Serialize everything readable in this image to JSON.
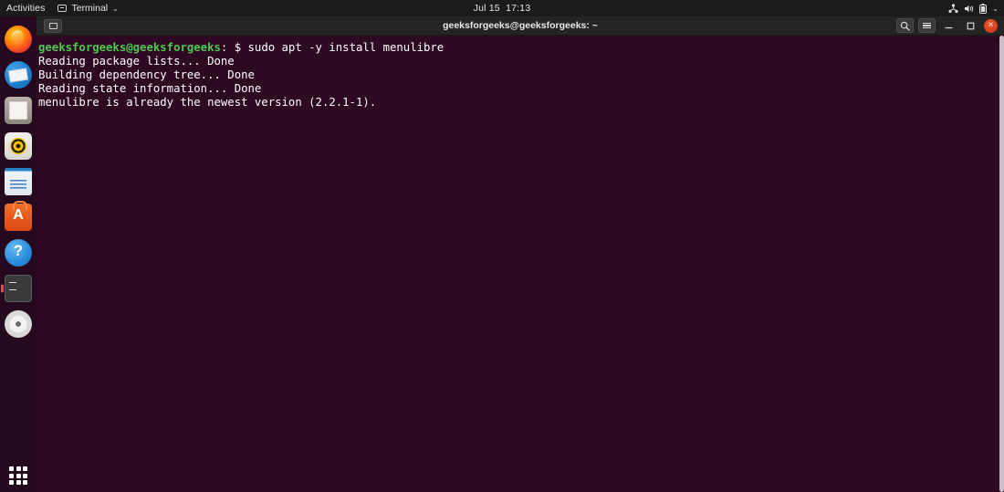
{
  "topbar": {
    "activities": "Activities",
    "app_menu": {
      "label": "Terminal",
      "icon": "terminal-icon",
      "chevron": "⌄"
    },
    "clock": "Jul 15  17:13",
    "tray": [
      {
        "name": "network-icon"
      },
      {
        "name": "volume-icon"
      },
      {
        "name": "battery-icon"
      },
      {
        "name": "chevron-down-icon",
        "glyph": "⌄"
      }
    ]
  },
  "dock": {
    "items": [
      {
        "name": "firefox",
        "label": "Firefox",
        "icon": "firefox-icon",
        "active": false
      },
      {
        "name": "thunderbird",
        "label": "Thunderbird Mail",
        "icon": "mail-icon",
        "active": false
      },
      {
        "name": "files",
        "label": "Files",
        "icon": "files-icon",
        "active": false
      },
      {
        "name": "rhythmbox",
        "label": "Rhythmbox",
        "icon": "music-icon",
        "active": false
      },
      {
        "name": "libreoffice-writer",
        "label": "LibreOffice Writer",
        "icon": "document-icon",
        "active": false
      },
      {
        "name": "ubuntu-software",
        "label": "Ubuntu Software",
        "icon": "software-bag-icon",
        "active": false
      },
      {
        "name": "help",
        "label": "Help",
        "icon": "help-icon",
        "active": false
      },
      {
        "name": "terminal",
        "label": "Terminal",
        "icon": "terminal-icon",
        "active": true
      },
      {
        "name": "disc",
        "label": "Disc",
        "icon": "disc-icon",
        "active": false
      }
    ],
    "show_applications": "Show Applications"
  },
  "window": {
    "title": "geeksforgeeks@geeksforgeeks: ~",
    "new_tab_label": "New Tab",
    "buttons": {
      "search": "search-icon",
      "menu": "hamburger-menu-icon",
      "minimize": "—",
      "maximize": "□",
      "close": "×"
    }
  },
  "terminal": {
    "prompt_user": "geeksforgeeks@geeksforgeeks",
    "prompt_rest": ": $ ",
    "command": "sudo apt -y install menulibre",
    "output": [
      "Reading package lists... Done",
      "Building dependency tree... Done",
      "Reading state information... Done",
      "menulibre is already the newest version (2.2.1-1)."
    ]
  },
  "colors": {
    "terminal_bg": "#2d0922",
    "prompt_green": "#4ec94e",
    "topbar_bg": "#1b1b1b",
    "titlebar_bg": "#242424",
    "close_button": "#e4502a",
    "running_indicator": "#e25822"
  }
}
